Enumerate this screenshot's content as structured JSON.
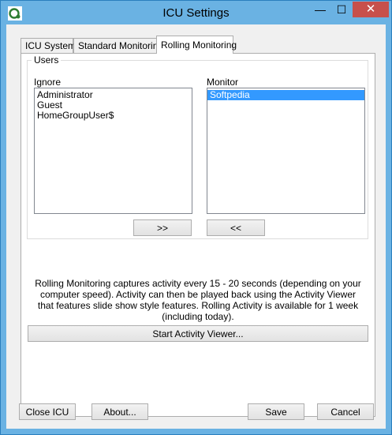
{
  "window": {
    "title": "ICU Settings",
    "minimize_glyph": "—",
    "maximize_glyph": "☐",
    "close_glyph": "✕"
  },
  "tabs": [
    {
      "label": "ICU System"
    },
    {
      "label": "Standard Monitoring"
    },
    {
      "label": "Rolling Monitoring",
      "active": true
    }
  ],
  "users_group": {
    "legend": "Users",
    "ignore_label": "Ignore",
    "monitor_label": "Monitor",
    "ignore_items": [
      "Administrator",
      "Guest",
      "HomeGroupUser$"
    ],
    "monitor_items": [
      "Softpedia"
    ],
    "monitor_selected": "Softpedia",
    "move_right_label": ">>",
    "move_left_label": "<<"
  },
  "description": "Rolling Monitoring captures activity every 15 - 20 seconds (depending on your computer speed). Activity can then be played back using the Activity Viewer that features slide show style features.  Rolling Activity is available for 1 week (including today).",
  "start_viewer_label": "Start Activity Viewer...",
  "footer": {
    "close_label": "Close ICU",
    "about_label": "About...",
    "save_label": "Save",
    "cancel_label": "Cancel"
  },
  "colors": {
    "titlebar": "#6ab2e3",
    "close_button": "#c7504b",
    "selection": "#3399ff"
  }
}
